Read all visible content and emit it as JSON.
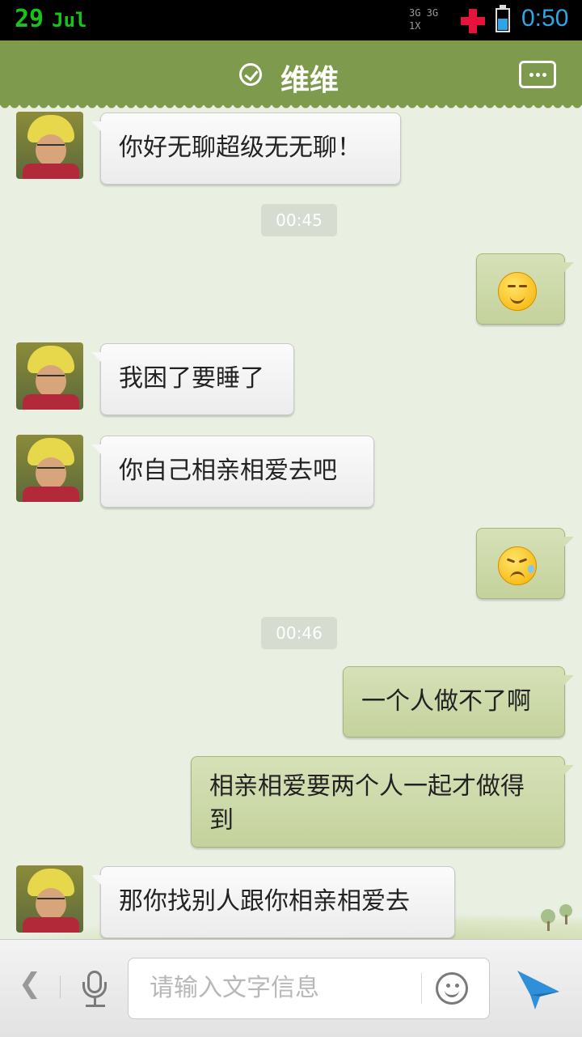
{
  "status_bar": {
    "date_day": "29",
    "date_month": "Jul",
    "network_top": "3G 3G 1X",
    "time": "0:50"
  },
  "header": {
    "title": "维维"
  },
  "messages": [
    {
      "type": "incoming",
      "text": "你好无聊超级无无聊！"
    },
    {
      "type": "timestamp",
      "text": "00:45"
    },
    {
      "type": "outgoing",
      "emoji": "smile-emoji"
    },
    {
      "type": "incoming",
      "text": "我困了要睡了"
    },
    {
      "type": "incoming",
      "text": "你自己相亲相爱去吧"
    },
    {
      "type": "outgoing",
      "emoji": "sweat-emoji"
    },
    {
      "type": "timestamp",
      "text": "00:46"
    },
    {
      "type": "outgoing",
      "text": "一个人做不了啊"
    },
    {
      "type": "outgoing",
      "text": "相亲相爱要两个人一起才做得到"
    },
    {
      "type": "incoming",
      "text": "那你找别人跟你相亲相爱去"
    }
  ],
  "input_bar": {
    "placeholder": "请输入文字信息"
  },
  "colors": {
    "header": "#7e9a4c",
    "background": "#e9efe1",
    "outgoing_bubble": "#c4d29c",
    "send_icon": "#2f8fd8"
  }
}
